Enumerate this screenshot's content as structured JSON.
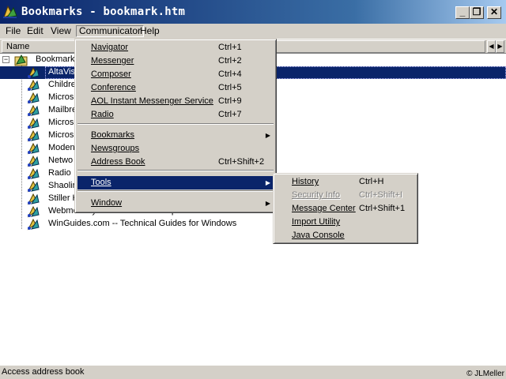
{
  "window": {
    "title": "Bookmarks - bookmark.htm",
    "minimize_glyph": "_",
    "maximize_glyph": "❐",
    "close_glyph": "✕"
  },
  "menubar": [
    "File",
    "Edit",
    "View",
    "Communicator",
    "Help"
  ],
  "column_header": "Name",
  "tree": {
    "root_label": "Bookmark",
    "collapse_glyph": "−",
    "items": [
      {
        "label": "AltaVis",
        "selected": true
      },
      {
        "label": "Childre"
      },
      {
        "label": "Micros"
      },
      {
        "label": "Mailbre"
      },
      {
        "label": "Micros"
      },
      {
        "label": "Micros"
      },
      {
        "label": "Moden"
      },
      {
        "label": "Netwo"
      },
      {
        "label": "Radio"
      },
      {
        "label": "Shaolir"
      },
      {
        "label": "Stiller H"
      },
      {
        "label": "Webmonkey -- The Web Developer's Resource"
      },
      {
        "label": "WinGuides.com -- Technical Guides for Windows"
      }
    ]
  },
  "communicator_menu": {
    "items": [
      {
        "label": "Navigator",
        "shortcut": "Ctrl+1"
      },
      {
        "label": "Messenger",
        "shortcut": "Ctrl+2"
      },
      {
        "label": "Composer",
        "shortcut": "Ctrl+4"
      },
      {
        "label": "Conference",
        "shortcut": "Ctrl+5"
      },
      {
        "label": "AOL Instant Messenger Service",
        "shortcut": "Ctrl+9"
      },
      {
        "label": "Radio",
        "shortcut": "Ctrl+7"
      },
      {
        "label": "Bookmarks",
        "shortcut": ""
      },
      {
        "label": "Newsgroups",
        "shortcut": ""
      },
      {
        "label": "Address Book",
        "shortcut": "Ctrl+Shift+2"
      },
      {
        "label": "Tools",
        "shortcut": ""
      },
      {
        "label": "Window",
        "shortcut": ""
      }
    ],
    "submenu_arrow": "▶"
  },
  "tools_menu": {
    "items": [
      {
        "label": "History",
        "shortcut": "Ctrl+H"
      },
      {
        "label": "Security Info",
        "shortcut": "Ctrl+Shift+I",
        "disabled": true
      },
      {
        "label": "Message Center",
        "shortcut": "Ctrl+Shift+1"
      },
      {
        "label": "Import Utility",
        "shortcut": ""
      },
      {
        "label": "Java Console",
        "shortcut": ""
      }
    ]
  },
  "statusbar": {
    "text": "Access address book",
    "credit": "© JLMeller"
  },
  "colors": {
    "title_start": "#0a246a",
    "highlight": "#0a246a",
    "face": "#d4d0c8"
  }
}
